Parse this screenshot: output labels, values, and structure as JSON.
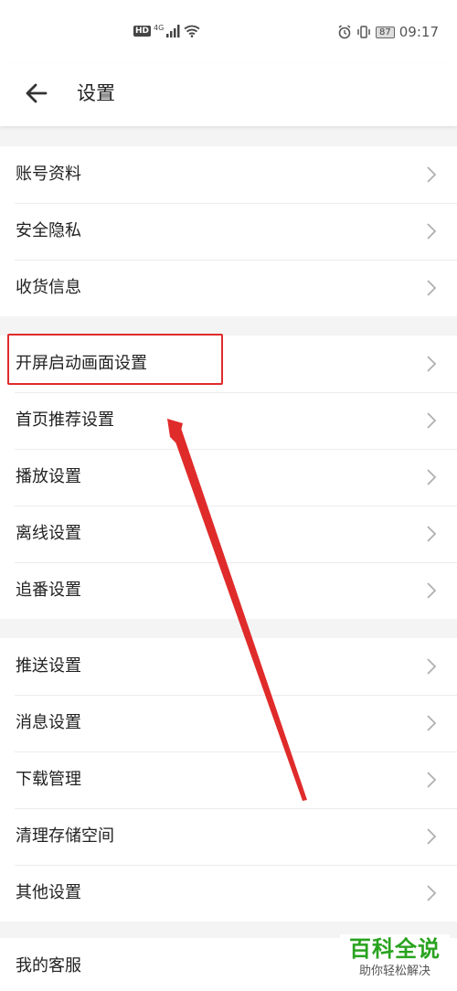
{
  "status_bar": {
    "hd": "HD",
    "network": "4G",
    "battery": "87",
    "time": "09:17"
  },
  "header": {
    "title": "设置",
    "back_icon": "arrow-left-icon"
  },
  "groups": [
    {
      "items": [
        {
          "label": "账号资料"
        },
        {
          "label": "安全隐私"
        },
        {
          "label": "收货信息"
        }
      ]
    },
    {
      "items": [
        {
          "label": "开屏启动画面设置"
        },
        {
          "label": "首页推荐设置"
        },
        {
          "label": "播放设置"
        },
        {
          "label": "离线设置"
        },
        {
          "label": "追番设置"
        }
      ]
    },
    {
      "items": [
        {
          "label": "推送设置"
        },
        {
          "label": "消息设置"
        },
        {
          "label": "下载管理"
        },
        {
          "label": "清理存储空间"
        },
        {
          "label": "其他设置"
        }
      ]
    },
    {
      "items": [
        {
          "label": "我的客服"
        }
      ]
    }
  ],
  "annotation": {
    "highlight_color": "#e02b2b",
    "highlighted_item": "开屏启动画面设置"
  },
  "watermark": {
    "title": "百科全说",
    "subtitle": "助你轻松解决"
  },
  "colors": {
    "background": "#f4f4f4",
    "chevron": "#b0b0b0",
    "watermark_green": "#29a31f"
  }
}
